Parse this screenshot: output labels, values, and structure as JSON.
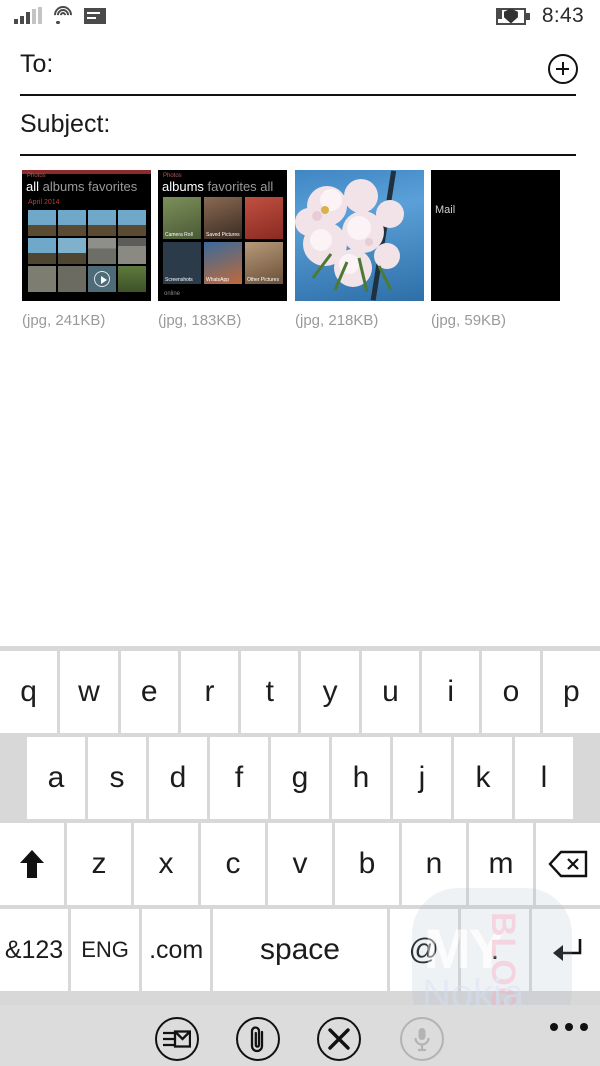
{
  "status_bar": {
    "signal_icon": "signal-bars-icon",
    "signal_bars_filled": 3,
    "signal_bars_total": 5,
    "wifi_icon": "wifi-icon",
    "sim_icon": "sim-card-icon",
    "battery_icon": "battery-saver-icon",
    "time": "8:43"
  },
  "compose": {
    "to": {
      "label": "To:",
      "value": "",
      "add_contact_icon": "add-contact-icon"
    },
    "subject": {
      "label": "Subject:",
      "value": ""
    }
  },
  "attachments": [
    {
      "caption": "(jpg, 241KB)",
      "kind": "photos-app-screenshot",
      "app_title": "Photos",
      "pivot_selected": "all",
      "pivot_rest": "albums favorites",
      "date_group": "April 2014"
    },
    {
      "caption": "(jpg, 183KB)",
      "kind": "photos-albums-screenshot",
      "app_title": "Photos",
      "pivot_selected": "albums",
      "pivot_rest": "favorites all",
      "tiles": [
        "Camera Roll",
        "Saved Pictures",
        "",
        "Screenshots",
        "WhatsApp",
        "Other Pictures"
      ],
      "footer": "online"
    },
    {
      "caption": "(jpg, 218KB)",
      "kind": "photo-cherry-blossoms"
    },
    {
      "caption": "(jpg, 59KB)",
      "kind": "mail-screenshot",
      "label": "Mail"
    }
  ],
  "keyboard": {
    "row1": [
      "q",
      "w",
      "e",
      "r",
      "t",
      "y",
      "u",
      "i",
      "o",
      "p"
    ],
    "row2": [
      "a",
      "s",
      "d",
      "f",
      "g",
      "h",
      "j",
      "k",
      "l"
    ],
    "row3_letters": [
      "z",
      "x",
      "c",
      "v",
      "b",
      "n",
      "m"
    ],
    "shift_icon": "shift-arrow-icon",
    "backspace_icon": "backspace-icon",
    "row4": {
      "symbols": "&123",
      "language": "ENG",
      "dotcom": ".com",
      "space": "space",
      "at": "@",
      "period": ".",
      "enter_icon": "enter-return-icon"
    }
  },
  "app_bar": {
    "send_icon": "send-mail-icon",
    "attach_icon": "paperclip-attach-icon",
    "close_icon": "close-x-icon",
    "mic_icon": "microphone-icon",
    "mic_disabled": true,
    "more_icon": "more-ellipsis-icon"
  },
  "watermark": {
    "line1": "MY",
    "line2": "Nokia",
    "line3": "BLOG"
  }
}
